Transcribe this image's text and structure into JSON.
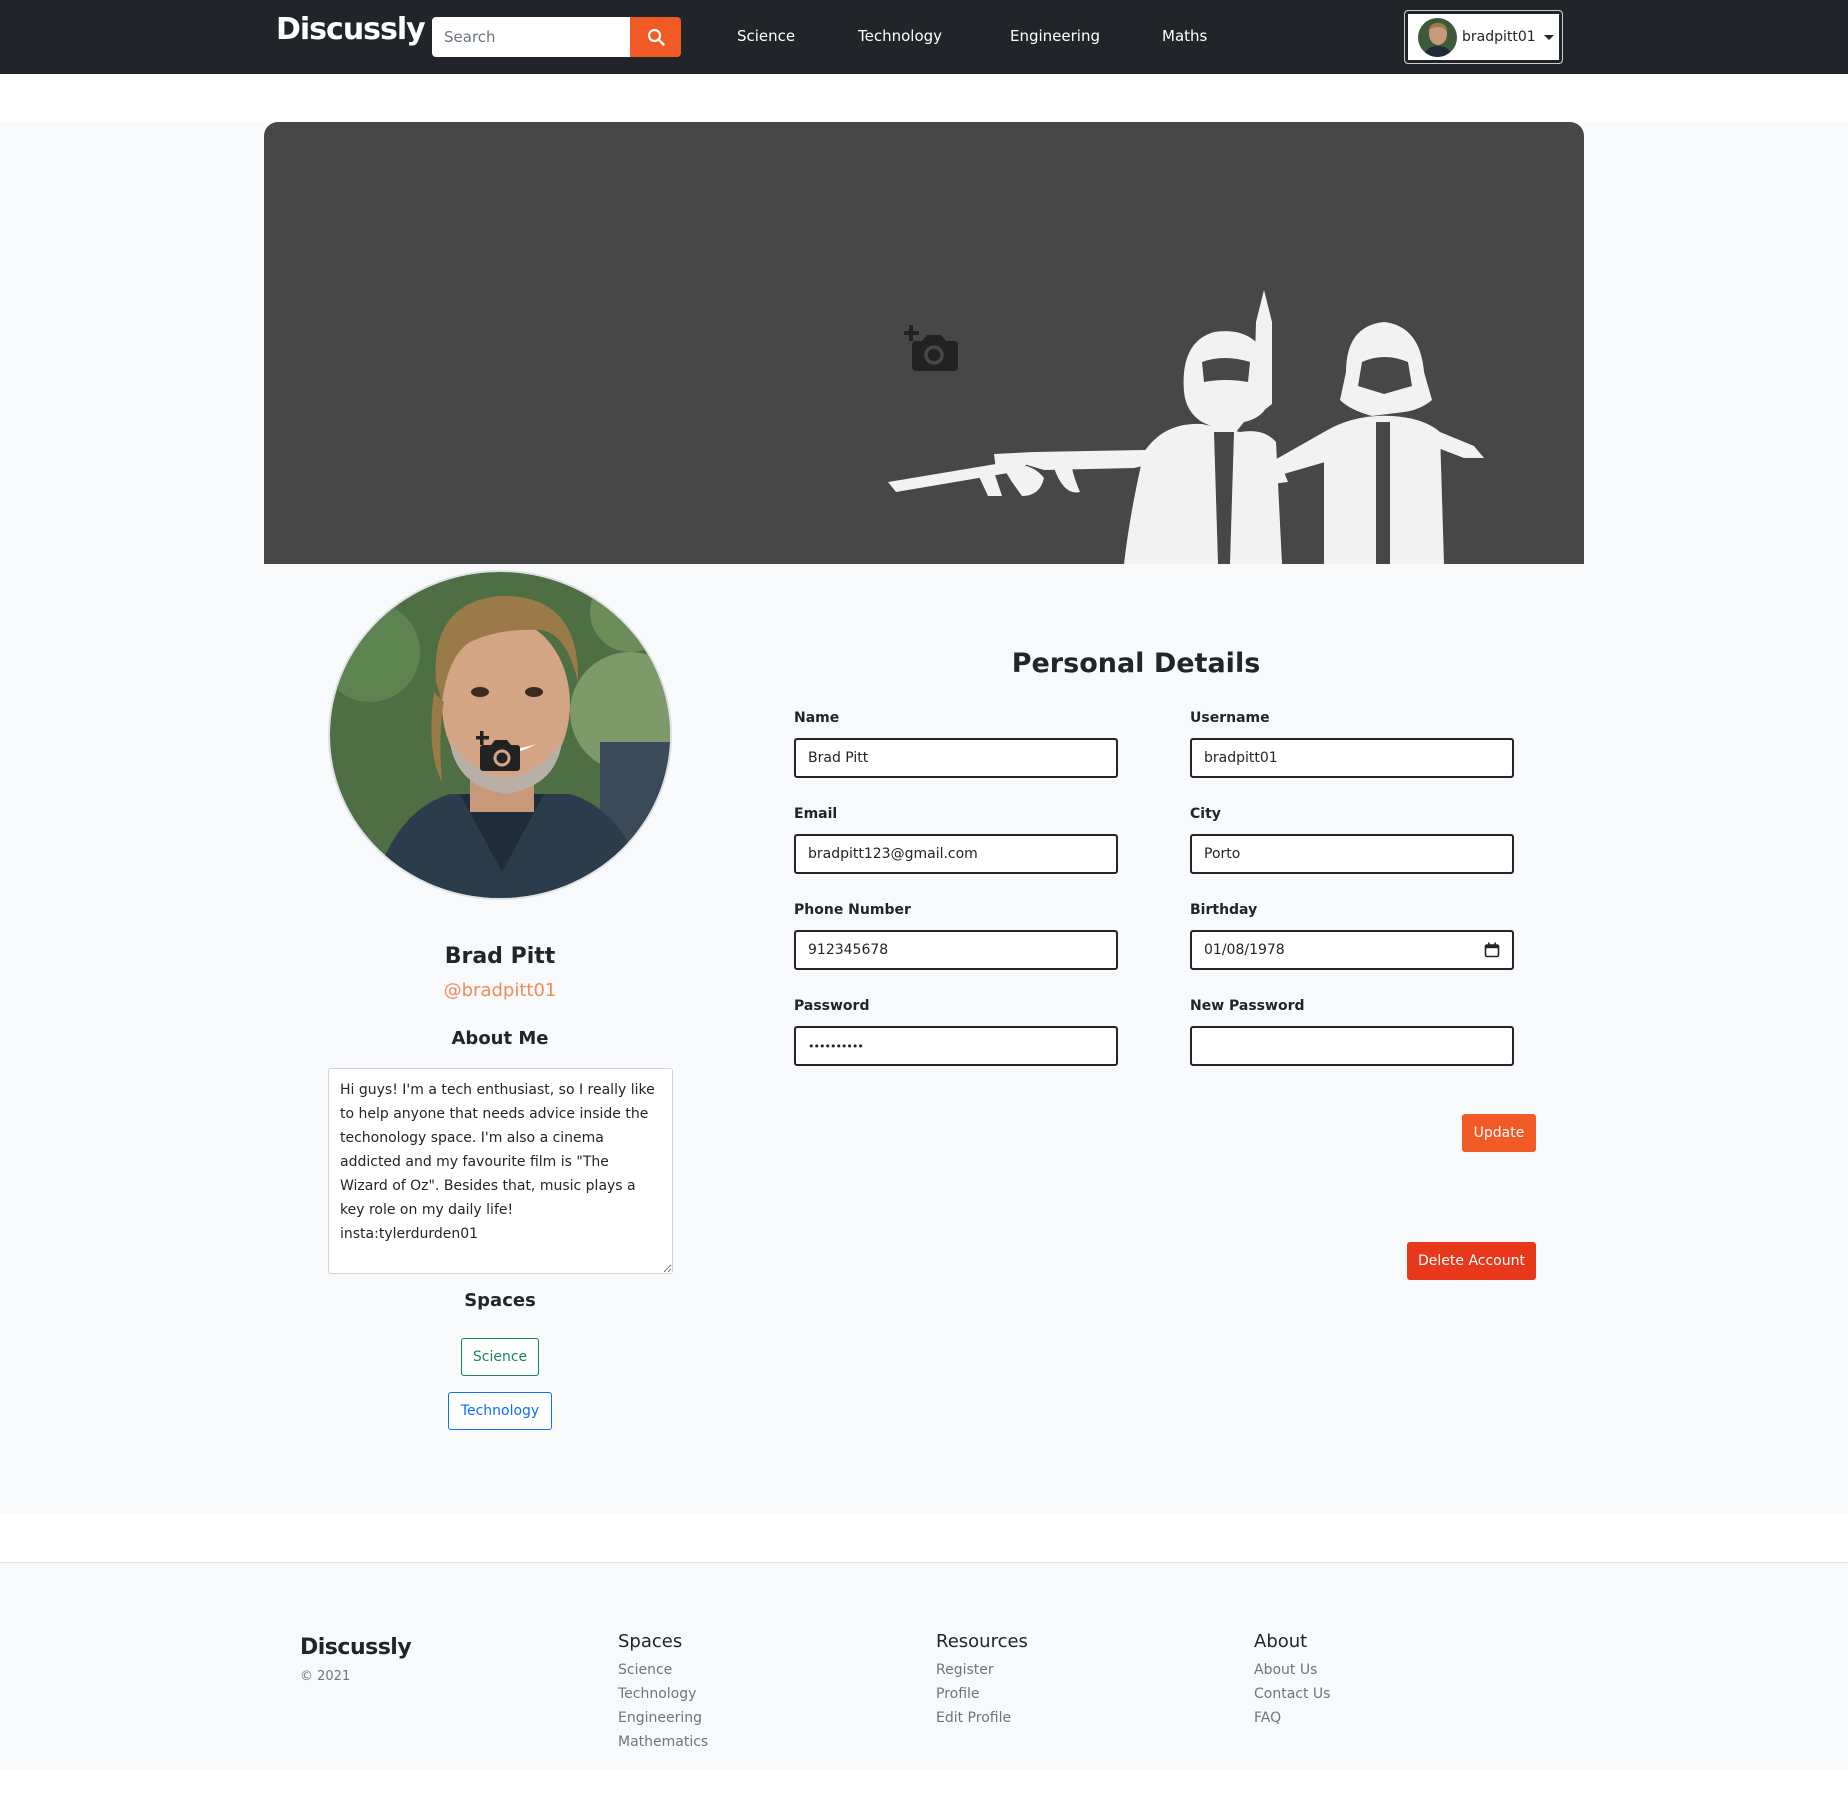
{
  "navbar": {
    "brand": "Discussly",
    "search_placeholder": "Search",
    "links": [
      "Science",
      "Technology",
      "Engineering",
      "Maths"
    ],
    "username": "bradpitt01"
  },
  "profile": {
    "name": "Brad Pitt",
    "handle": "@bradpitt01",
    "about_title": "About Me",
    "about_text": "Hi guys! I'm a tech enthusiast, so I really like to help anyone that needs advice inside the techonology space. I'm also a cinema addicted and my favourite film is \"The Wizard of Oz\". Besides that, music plays a key role on my daily life!\ninsta:tylerdurden01",
    "spaces_title": "Spaces",
    "spaces": [
      "Science",
      "Technology"
    ]
  },
  "details": {
    "title": "Personal Details",
    "name_label": "Name",
    "name_value": "Brad Pitt",
    "username_label": "Username",
    "username_value": "bradpitt01",
    "email_label": "Email",
    "email_value": "bradpitt123@gmail.com",
    "city_label": "City",
    "city_value": "Porto",
    "phone_label": "Phone Number",
    "phone_value": "912345678",
    "birthday_label": "Birthday",
    "birthday_value": "01/08/1978",
    "password_label": "Password",
    "password_value": "••••••••••",
    "new_password_label": "New Password",
    "new_password_value": "",
    "update_label": "Update",
    "delete_label": "Delete Account"
  },
  "footer": {
    "brand": "Discussly",
    "copyright": "© 2021",
    "spaces_title": "Spaces",
    "spaces_links": [
      "Science",
      "Technology",
      "Engineering",
      "Mathematics"
    ],
    "resources_title": "Resources",
    "resources_links": [
      "Register",
      "Profile",
      "Edit Profile"
    ],
    "about_title": "About",
    "about_links": [
      "About Us",
      "Contact Us",
      "FAQ"
    ]
  },
  "colors": {
    "accent": "#f15a24",
    "danger": "#e8381c",
    "navbar": "#212529",
    "cover": "#474747",
    "handle": "#f08c5a"
  },
  "icons": [
    "search-icon",
    "add-photo-icon",
    "calendar-icon",
    "caret-down-icon"
  ]
}
